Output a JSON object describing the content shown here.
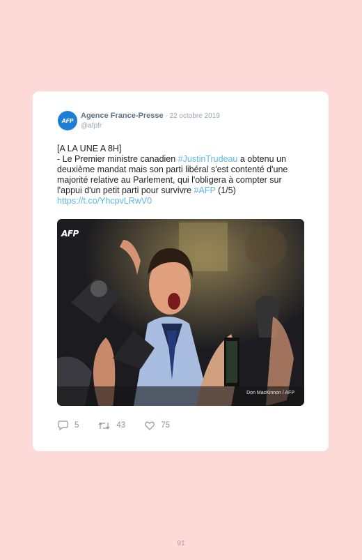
{
  "tweet": {
    "avatar_text": "AFP",
    "author": "Agence France-Presse",
    "separator": " · ",
    "date": "22 octobre 2019",
    "handle": "@afpfr",
    "text_lines": [
      [
        {
          "t": "[A LA UNE A 8H]"
        }
      ],
      [
        {
          "t": "- Le Premier ministre canadien "
        },
        {
          "t": "#JustinTrudeau",
          "hashtag": true
        },
        {
          "t": " a obtenu un"
        }
      ],
      [
        {
          "t": "deuxième mandat mais son parti libéral s'est contenté d'une"
        }
      ],
      [
        {
          "t": "majorité relative au Parlement, qui l'obligera à compter sur"
        }
      ],
      [
        {
          "t": "l'appui d'un petit parti pour survivre "
        },
        {
          "t": "#AFP",
          "hashtag": true
        },
        {
          "t": " (1/5)"
        }
      ],
      [
        {
          "t": "https://t.co/YhcpvLRwV0",
          "hashtag": true
        }
      ]
    ],
    "media": {
      "logo_text": "AFP",
      "credit": "Don MacKinnon / AFP"
    },
    "stats": {
      "replies": "5",
      "retweets": "43",
      "likes": "75"
    },
    "icons": [
      "reply-icon",
      "retweet-icon",
      "heart-icon"
    ]
  },
  "page_number": "91",
  "colors": {
    "background": "#fdd9d8",
    "card": "#ffffff",
    "link": "#5fb6e8",
    "avatar": "#1d7ed6"
  }
}
